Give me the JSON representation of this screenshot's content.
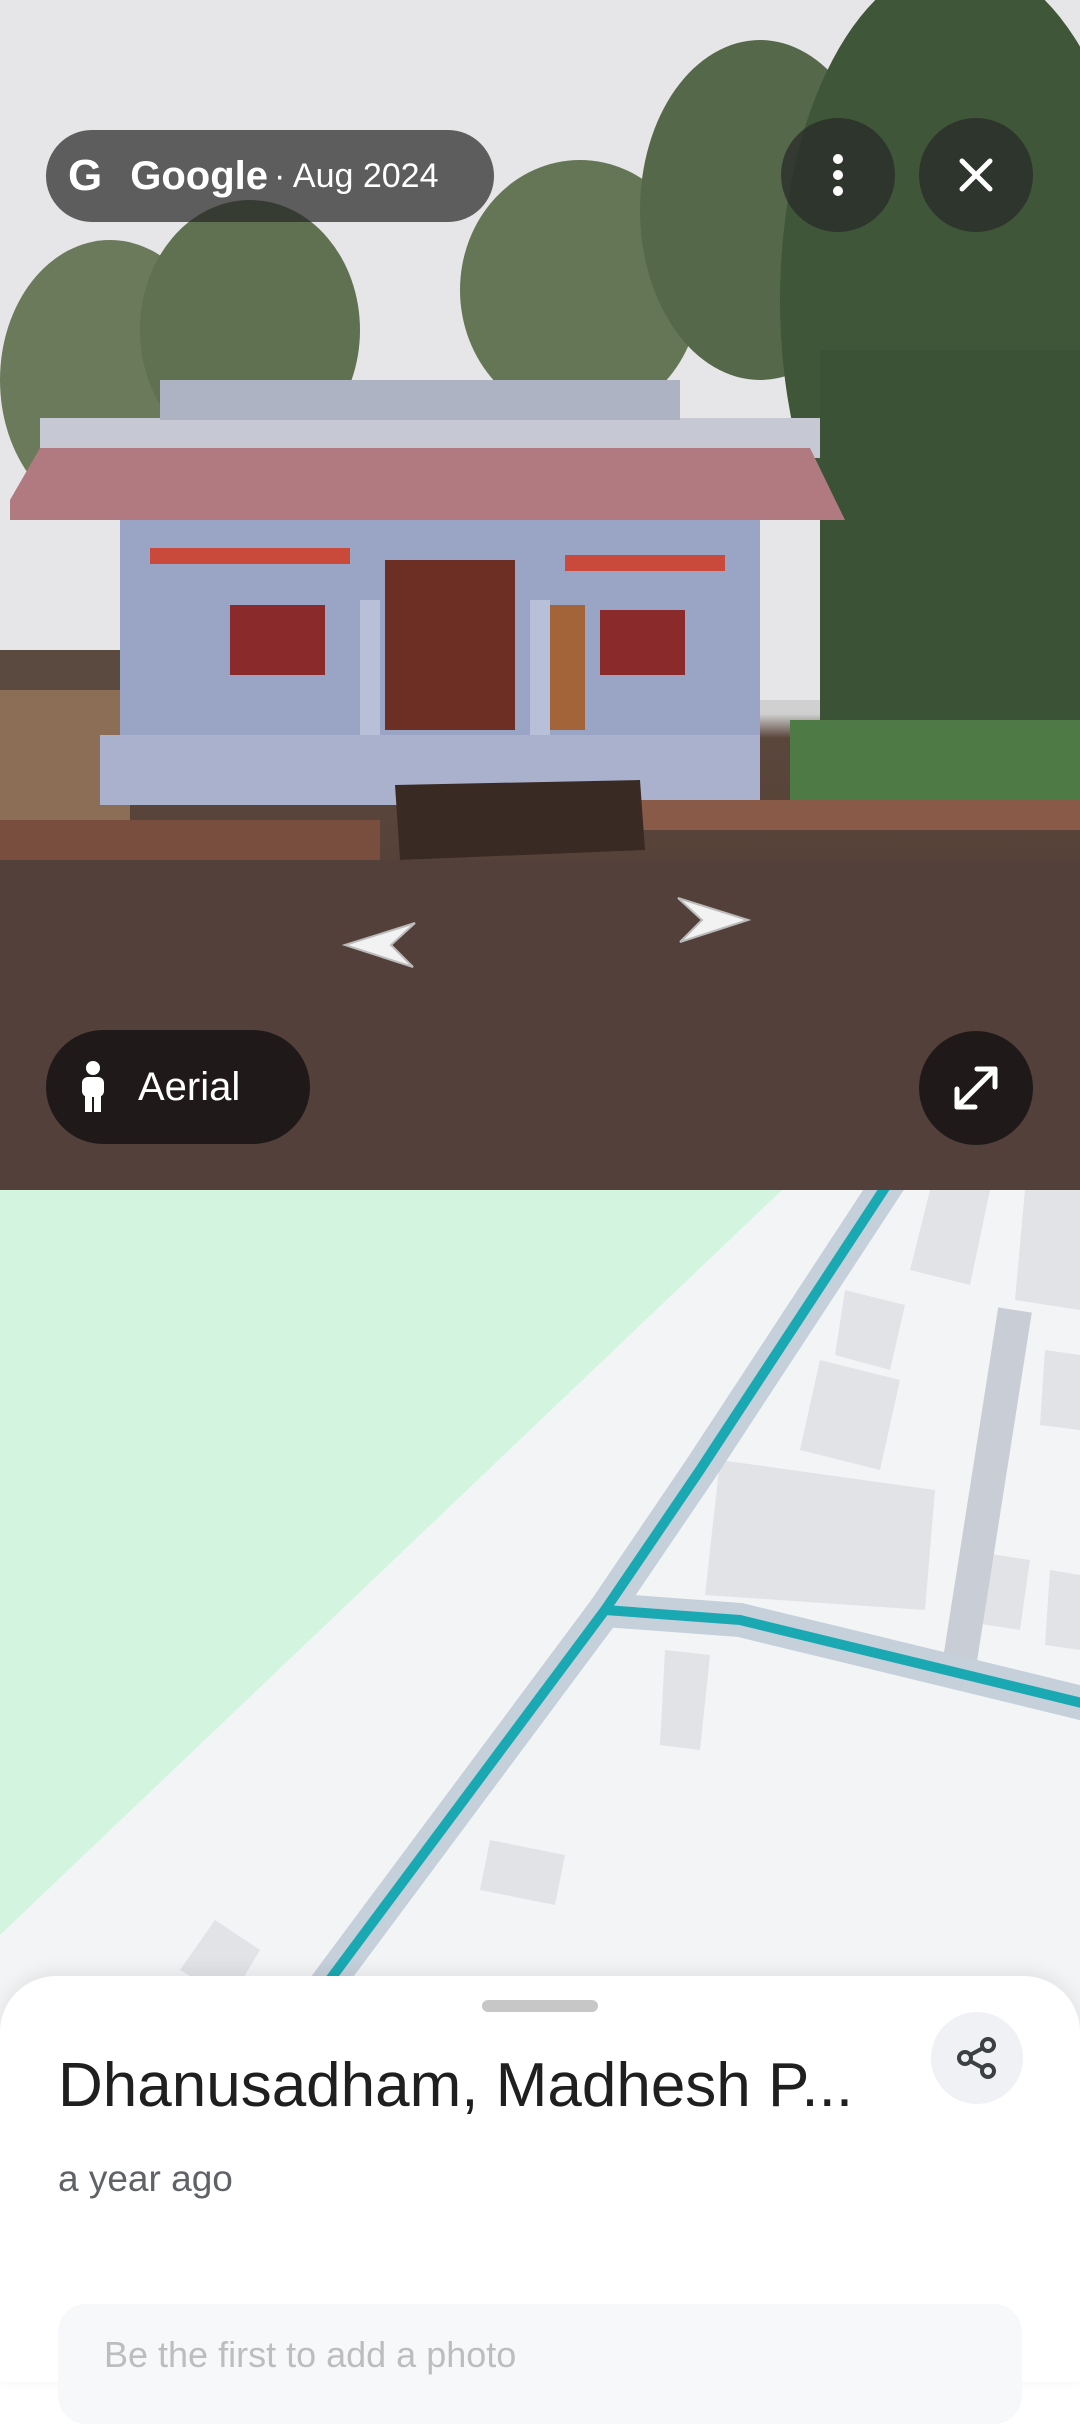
{
  "streetview": {
    "attribution": {
      "brand": "Google",
      "date": "· Aug 2024"
    },
    "more_icon": "more-vertical-icon",
    "close_icon": "close-icon",
    "expand_icon": "expand-icon",
    "aerial": {
      "label": "Aerial",
      "icon": "pegman-icon"
    }
  },
  "place": {
    "title": "Dhanusadham, Madhesh P...",
    "time_ago": "a year ago",
    "share_icon": "share-icon",
    "photo_prompt": "Be the first to add a photo"
  },
  "colors": {
    "road_highlight": "#1aa9b3",
    "park": "#d3f5e0",
    "map_bg": "#f3f4f6"
  }
}
